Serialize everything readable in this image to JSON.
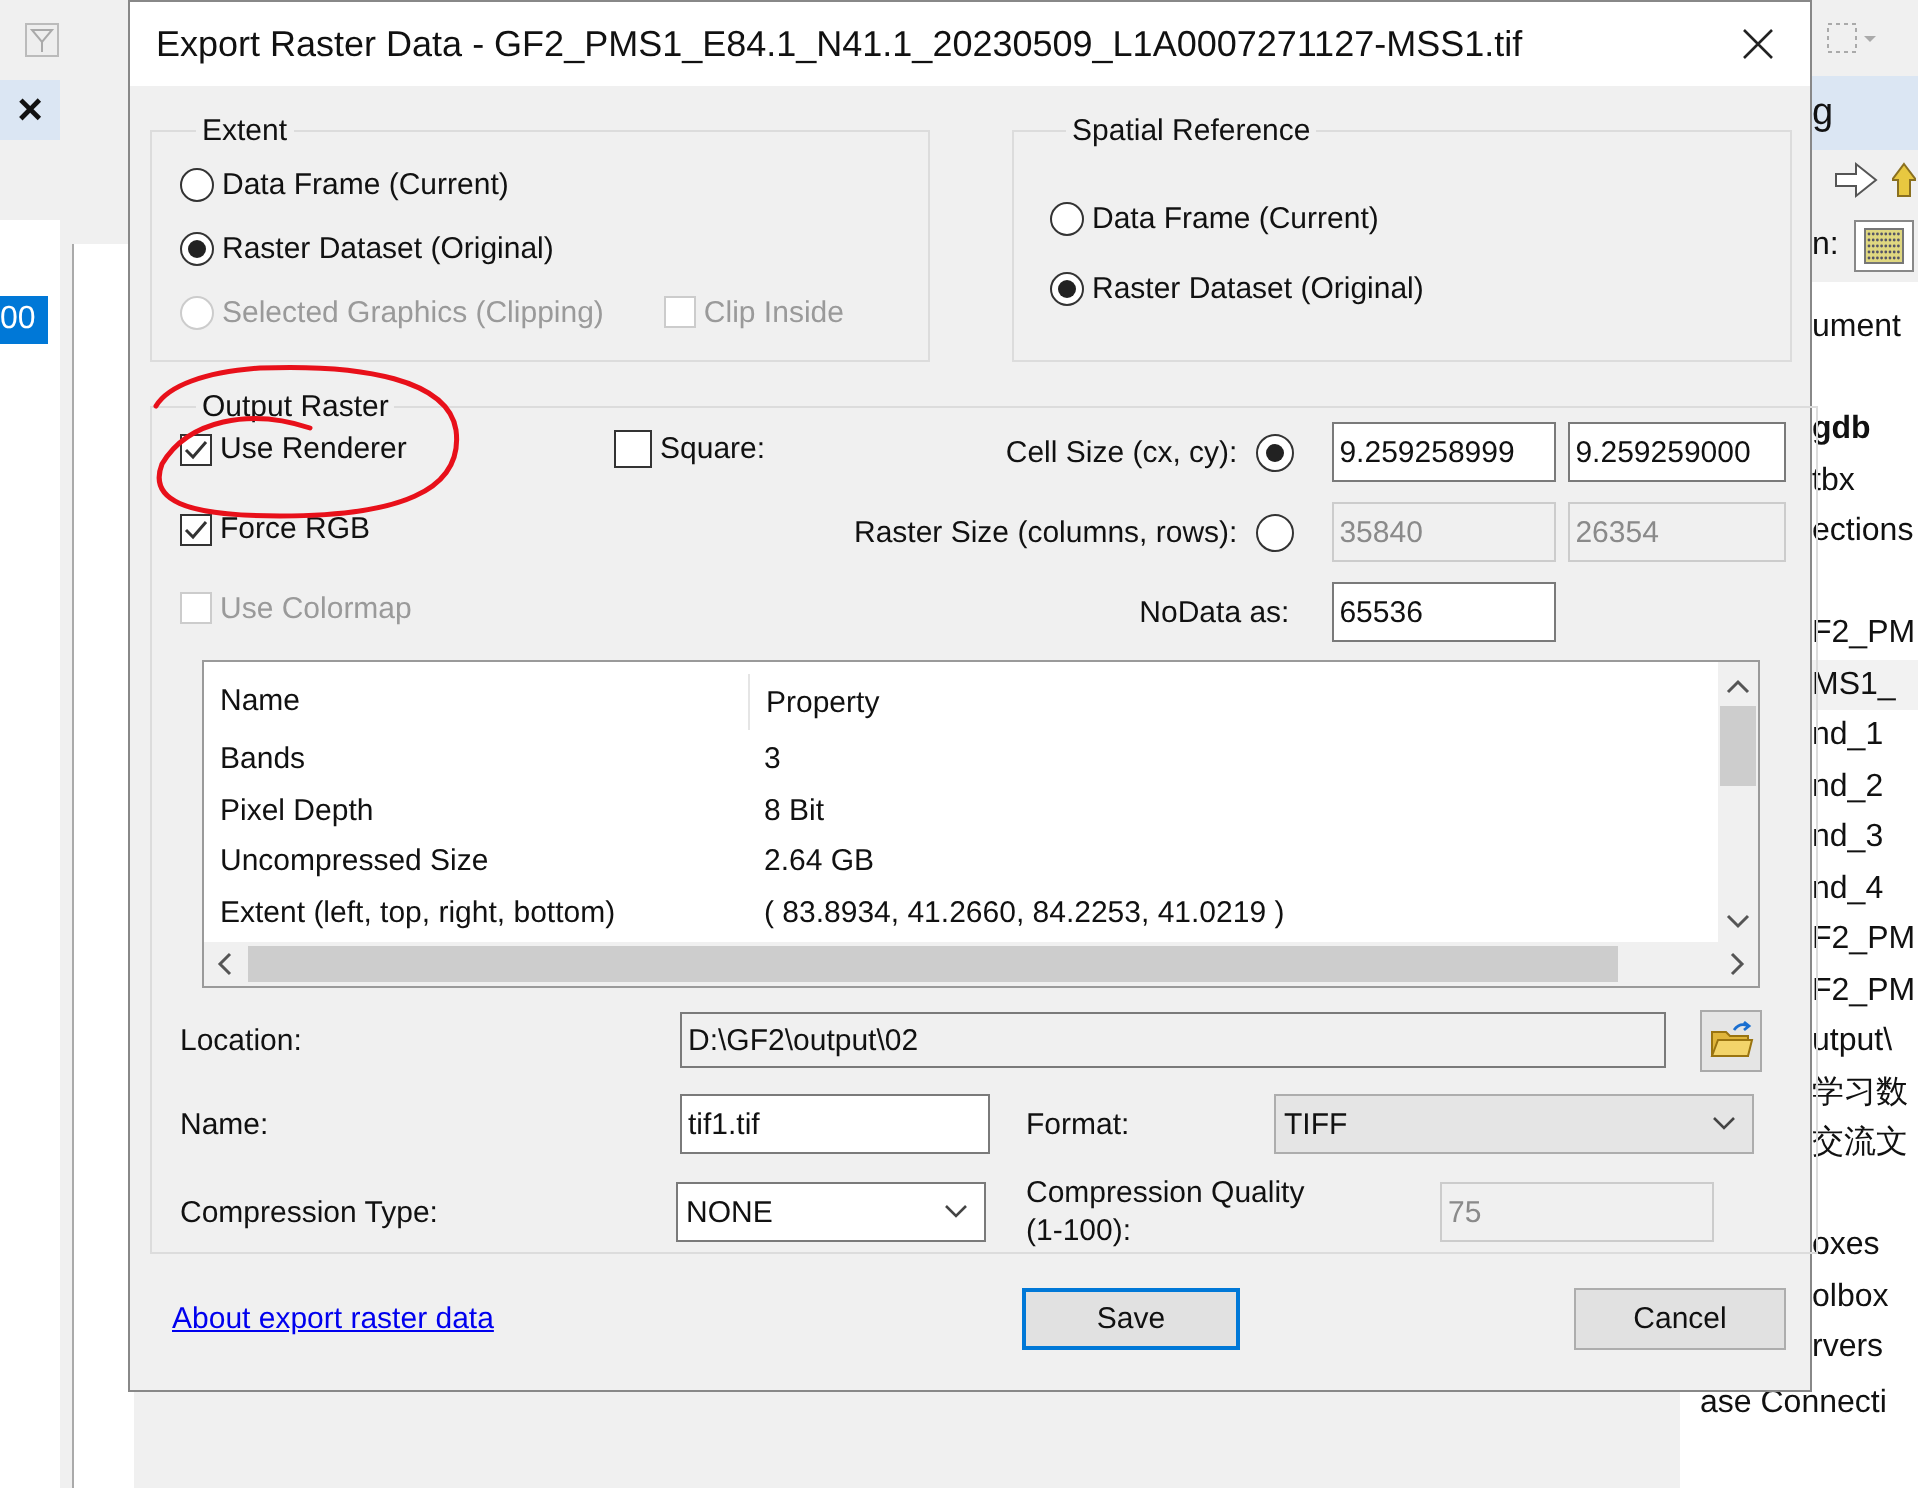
{
  "left_panel": {
    "close": "×",
    "items": [
      {
        "label": "00",
        "selected": true
      }
    ]
  },
  "right_panel": {
    "title": "g",
    "location_label": "n:",
    "groups": [
      {
        "items": [
          {
            "label": "ument",
            "bold": false,
            "selected": false
          }
        ]
      },
      {
        "items": [
          {
            "label": "gdb",
            "bold": true,
            "selected": false
          },
          {
            "label": "tbx",
            "bold": false,
            "selected": false
          },
          {
            "label": "ections",
            "bold": false,
            "selected": false
          }
        ]
      },
      {
        "items": [
          {
            "label": "F2_PM",
            "bold": false,
            "selected": false
          },
          {
            "label": "MS1_",
            "bold": false,
            "selected": true
          },
          {
            "label": "nd_1",
            "bold": false,
            "selected": false
          },
          {
            "label": "nd_2",
            "bold": false,
            "selected": false
          },
          {
            "label": "nd_3",
            "bold": false,
            "selected": false
          },
          {
            "label": "nd_4",
            "bold": false,
            "selected": false
          },
          {
            "label": "F2_PM",
            "bold": false,
            "selected": false
          },
          {
            "label": "F2_PM",
            "bold": false,
            "selected": false
          },
          {
            "label": "utput\\",
            "bold": false,
            "selected": false
          },
          {
            "label": "学习数",
            "bold": false,
            "selected": false
          },
          {
            "label": "交流文",
            "bold": false,
            "selected": false
          }
        ]
      },
      {
        "items": [
          {
            "label": "oxes",
            "bold": false,
            "selected": false
          },
          {
            "label": "olbox",
            "bold": false,
            "selected": false
          },
          {
            "label": "rvers",
            "bold": false,
            "selected": false
          },
          {
            "label": "ase Connecti",
            "bold": false,
            "selected": false
          }
        ]
      }
    ]
  },
  "window": {
    "title": "Export Raster Data - GF2_PMS1_E84.1_N41.1_20230509_L1A0007271127-MSS1.tif"
  },
  "extent": {
    "title": "Extent",
    "options": [
      {
        "label": "Data Frame (Current)",
        "selected": false,
        "disabled": false
      },
      {
        "label": "Raster Dataset (Original)",
        "selected": true,
        "disabled": false
      },
      {
        "label": "Selected Graphics (Clipping)",
        "selected": false,
        "disabled": true
      }
    ],
    "clip_inside": {
      "label": "Clip Inside",
      "checked": false,
      "disabled": true
    }
  },
  "spatial_reference": {
    "title": "Spatial Reference",
    "options": [
      {
        "label": "Data Frame (Current)",
        "selected": false,
        "disabled": false
      },
      {
        "label": "Raster Dataset (Original)",
        "selected": true,
        "disabled": false
      }
    ]
  },
  "output_raster": {
    "title": "Output Raster",
    "use_renderer": {
      "label": "Use Renderer",
      "checked": true,
      "disabled": false
    },
    "force_rgb": {
      "label": "Force RGB",
      "checked": true,
      "disabled": false
    },
    "use_colormap": {
      "label": "Use Colormap",
      "checked": false,
      "disabled": true
    },
    "square": {
      "label": "Square:",
      "checked": false,
      "disabled": false
    },
    "cell_size": {
      "label": "Cell Size (cx, cy):",
      "selected": true,
      "values": [
        "9.259258999",
        "9.259259000"
      ]
    },
    "raster_size": {
      "label": "Raster Size (columns, rows):",
      "selected": false,
      "values": [
        "35840",
        "26354"
      ]
    },
    "nodata": {
      "label": "NoData as:",
      "value": "65536"
    }
  },
  "properties": {
    "columns": [
      "Name",
      "Property"
    ],
    "rows": [
      [
        "Bands",
        "3"
      ],
      [
        "Pixel Depth",
        "8 Bit"
      ],
      [
        "Uncompressed Size",
        "2.64 GB"
      ],
      [
        "Extent (left, top, right, bottom)",
        "( 83.8934, 41.2660, 84.2253, 41.0219 )"
      ]
    ]
  },
  "location": {
    "label": "Location:",
    "value": "D:\\GF2\\output\\02"
  },
  "name": {
    "label": "Name:",
    "value": "tif1.tif"
  },
  "format": {
    "label": "Format:",
    "value": "TIFF"
  },
  "compression_type": {
    "label": "Compression Type:",
    "value": "NONE"
  },
  "compression_quality": {
    "label": "Compression Quality (1-100):",
    "value": "75",
    "disabled": true
  },
  "help_link": "About export raster data",
  "buttons": [
    {
      "label": "Save",
      "default": true
    },
    {
      "label": "Cancel",
      "default": false
    }
  ]
}
